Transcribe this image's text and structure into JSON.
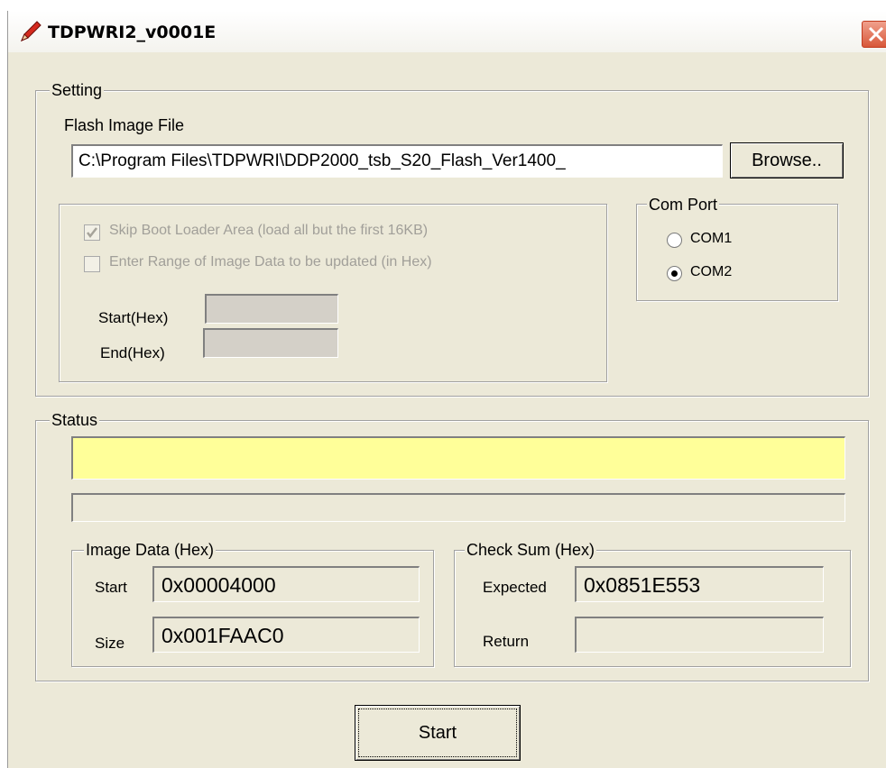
{
  "window": {
    "title": "TDPWRI2_v0001E"
  },
  "setting": {
    "legend": "Setting",
    "flash_label": "Flash Image File",
    "flash_path": "C:\\Program Files\\TDPWRI\\DDP2000_tsb_S20_Flash_Ver1400_",
    "browse_label": "Browse..",
    "skip_boot_label": "Skip Boot Loader Area (load all but the first 16KB)",
    "skip_boot_checked": true,
    "enter_range_label": "Enter Range of Image Data to be updated (in Hex)",
    "enter_range_checked": false,
    "start_label": "Start(Hex)",
    "end_label": "End(Hex)",
    "start_value": "",
    "end_value": ""
  },
  "com_port": {
    "legend": "Com Port",
    "options": [
      {
        "label": "COM1",
        "selected": false
      },
      {
        "label": "COM2",
        "selected": true
      }
    ]
  },
  "status": {
    "legend": "Status",
    "message": "",
    "progress": 0,
    "colors": {
      "message_bg": "#ffff99"
    }
  },
  "image_data": {
    "legend": "Image Data (Hex)",
    "start_label": "Start",
    "start_value": "0x00004000",
    "size_label": "Size",
    "size_value": "0x001FAAC0"
  },
  "checksum": {
    "legend": "Check Sum (Hex)",
    "expected_label": "Expected",
    "expected_value": "0x0851E553",
    "return_label": "Return",
    "return_value": ""
  },
  "actions": {
    "start_label": "Start"
  },
  "icons": {
    "app": "pencil-icon",
    "close": "close-icon"
  }
}
